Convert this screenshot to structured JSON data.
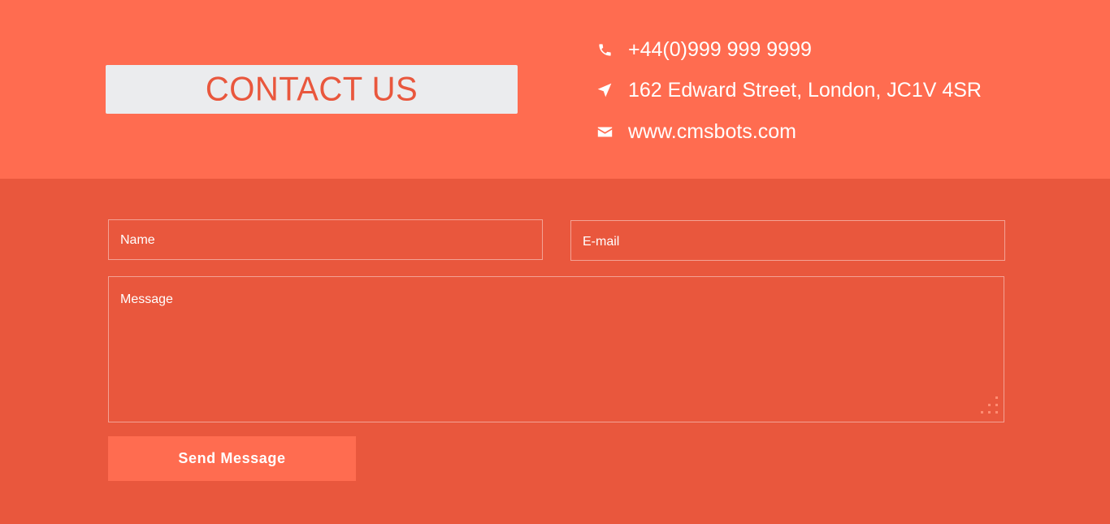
{
  "colors": {
    "top_band": "#ff6c50",
    "bottom_band": "#e9573d",
    "title_box": "#ebecee",
    "title_text": "#e9573d",
    "text": "#ffffff",
    "button": "#ff6c50"
  },
  "header": {
    "title": "CONTACT US"
  },
  "contact_info": [
    {
      "icon": "phone-icon",
      "text": "+44(0)999 999 9999"
    },
    {
      "icon": "location-arrow-icon",
      "text": "162 Edward Street, London, JC1V 4SR"
    },
    {
      "icon": "envelope-icon",
      "text": "www.cmsbots.com"
    }
  ],
  "form": {
    "name_placeholder": "Name",
    "email_placeholder": "E-mail",
    "message_placeholder": "Message",
    "submit_label": "Send Message"
  }
}
